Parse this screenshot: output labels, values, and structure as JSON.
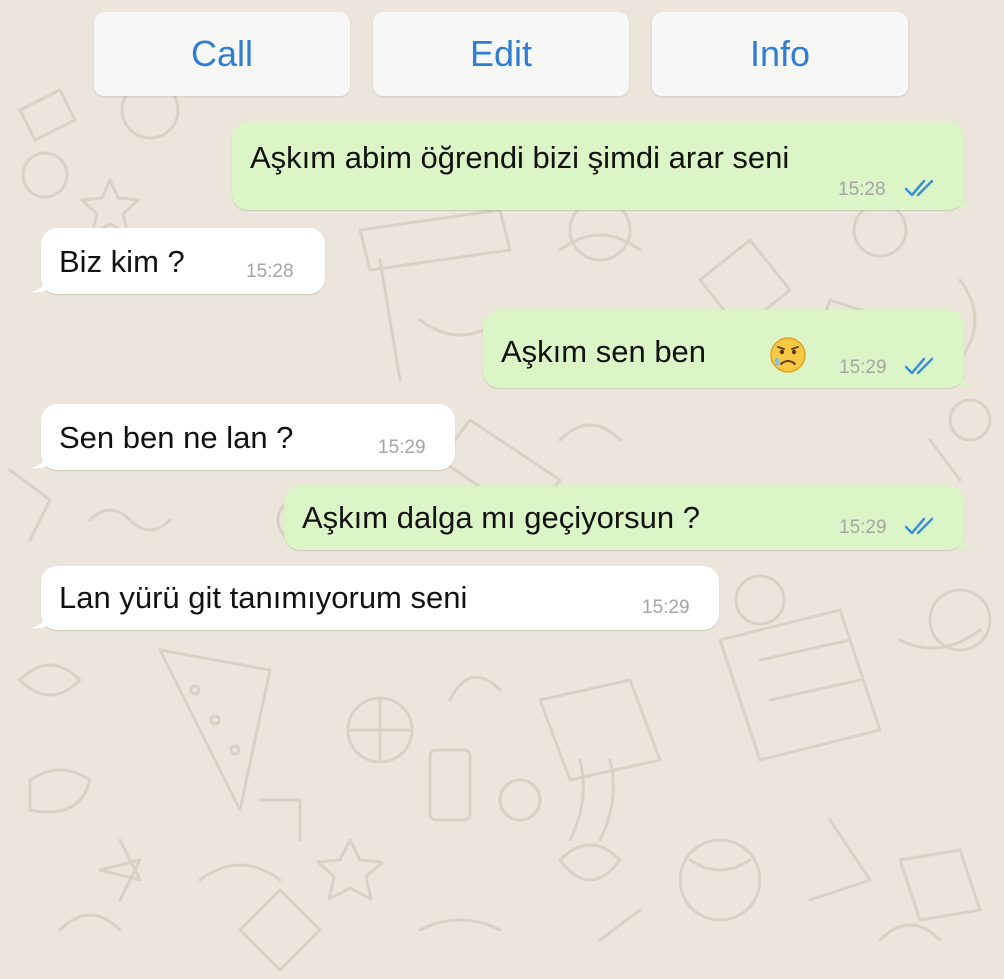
{
  "header": {
    "call_label": "Call",
    "edit_label": "Edit",
    "info_label": "Info"
  },
  "messages": [
    {
      "direction": "outgoing",
      "text": "Aşkım abim öğrendi bizi şimdi arar seni",
      "time": "15:28",
      "status": "read"
    },
    {
      "direction": "incoming",
      "text": "Biz kim ?",
      "time": "15:28"
    },
    {
      "direction": "outgoing",
      "text": "Aşkım sen ben",
      "emoji": "sad-relieved-face",
      "time": "15:29",
      "status": "read"
    },
    {
      "direction": "incoming",
      "text": "Sen ben ne lan ?",
      "time": "15:29"
    },
    {
      "direction": "outgoing",
      "text": "Aşkım dalga mı geçiyorsun ?",
      "time": "15:29",
      "status": "read"
    },
    {
      "direction": "incoming",
      "text": "Lan yürü git tanımıyorum seni",
      "time": "15:29"
    }
  ],
  "colors": {
    "accent": "#2e7fd1",
    "outgoing_bubble": "#dcf5c7",
    "incoming_bubble": "#ffffff",
    "read_ticks": "#3a8fd8",
    "background": "#ebe5dc"
  }
}
